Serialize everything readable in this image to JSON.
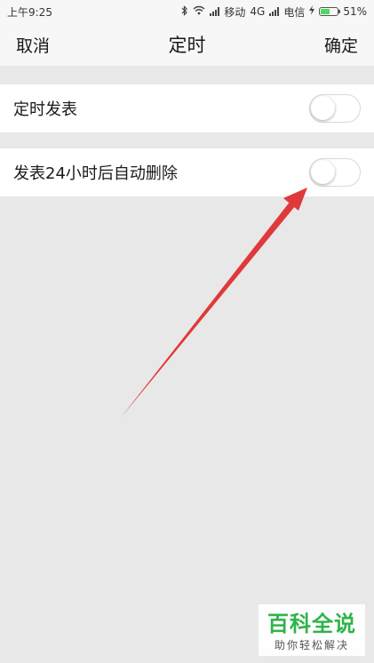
{
  "status_bar": {
    "time": "上午9:25",
    "carrier_1": "移动",
    "network": "4G",
    "carrier_2": "电信",
    "battery": "51%",
    "battery_level": 0.51
  },
  "nav": {
    "cancel_label": "取消",
    "title": "定时",
    "confirm_label": "确定"
  },
  "settings": {
    "items": [
      {
        "label": "定时发表",
        "enabled": false
      },
      {
        "label": "发表24小时后自动删除",
        "enabled": false
      }
    ]
  },
  "watermark": {
    "title": "百科全说",
    "subtitle": "助你轻松解决"
  },
  "colors": {
    "arrow": "#e0393b",
    "battery": "#4cd964",
    "watermark": "#2fb34a"
  }
}
